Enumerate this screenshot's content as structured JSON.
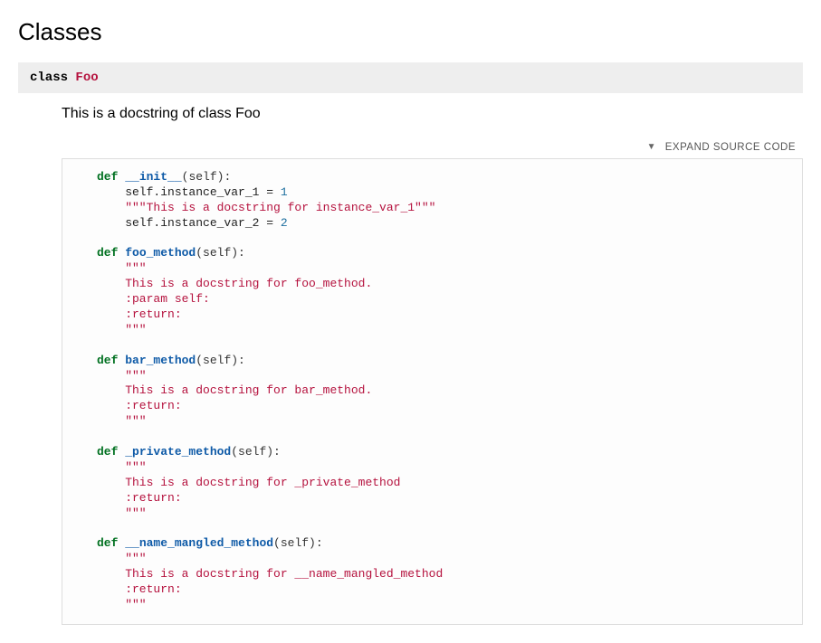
{
  "section_title": "Classes",
  "class_keyword": "class",
  "class_name": "Foo",
  "docstring": "This is a docstring of class Foo",
  "expand_label": "EXPAND SOURCE CODE",
  "code": {
    "def": "def",
    "self_param": "(self):",
    "m_init": "__init__",
    "init_line1a": "    self.instance_var_1 = ",
    "init_line1b": "1",
    "init_doc": "    \"\"\"This is a docstring for instance_var_1\"\"\"",
    "init_line2a": "    self.instance_var_2 = ",
    "init_line2b": "2",
    "m_foo": "foo_method",
    "foo_doc1": "    \"\"\"",
    "foo_doc2": "    This is a docstring for foo_method.",
    "foo_doc3": "    :param self:",
    "foo_doc4": "    :return:",
    "foo_doc5": "    \"\"\"",
    "m_bar": "bar_method",
    "bar_doc1": "    \"\"\"",
    "bar_doc2": "    This is a docstring for bar_method.",
    "bar_doc3": "    :return:",
    "bar_doc4": "    \"\"\"",
    "m_priv": "_private_method",
    "priv_doc1": "    \"\"\"",
    "priv_doc2": "    This is a docstring for _private_method",
    "priv_doc3": "    :return:",
    "priv_doc4": "    \"\"\"",
    "m_mangled": "__name_mangled_method",
    "mang_doc1": "    \"\"\"",
    "mang_doc2": "    This is a docstring for __name_mangled_method",
    "mang_doc3": "    :return:",
    "mang_doc4": "    \"\"\""
  }
}
